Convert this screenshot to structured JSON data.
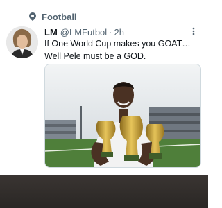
{
  "topic": {
    "label": "Football",
    "icon": "topic-pin-icon"
  },
  "tweet": {
    "display_name": "LM",
    "handle": "@LMFutbol",
    "separator": "·",
    "time": "2h",
    "text_line1": "If One World Cup makes you GOAT…",
    "text_line2": "Well Pele must be a GOD.",
    "more_icon": "more-icon"
  },
  "colors": {
    "primary_text": "#0f1419",
    "secondary_text": "#536471",
    "grass": "#4f7f3a",
    "trophy_gold": "#c9a23a"
  }
}
